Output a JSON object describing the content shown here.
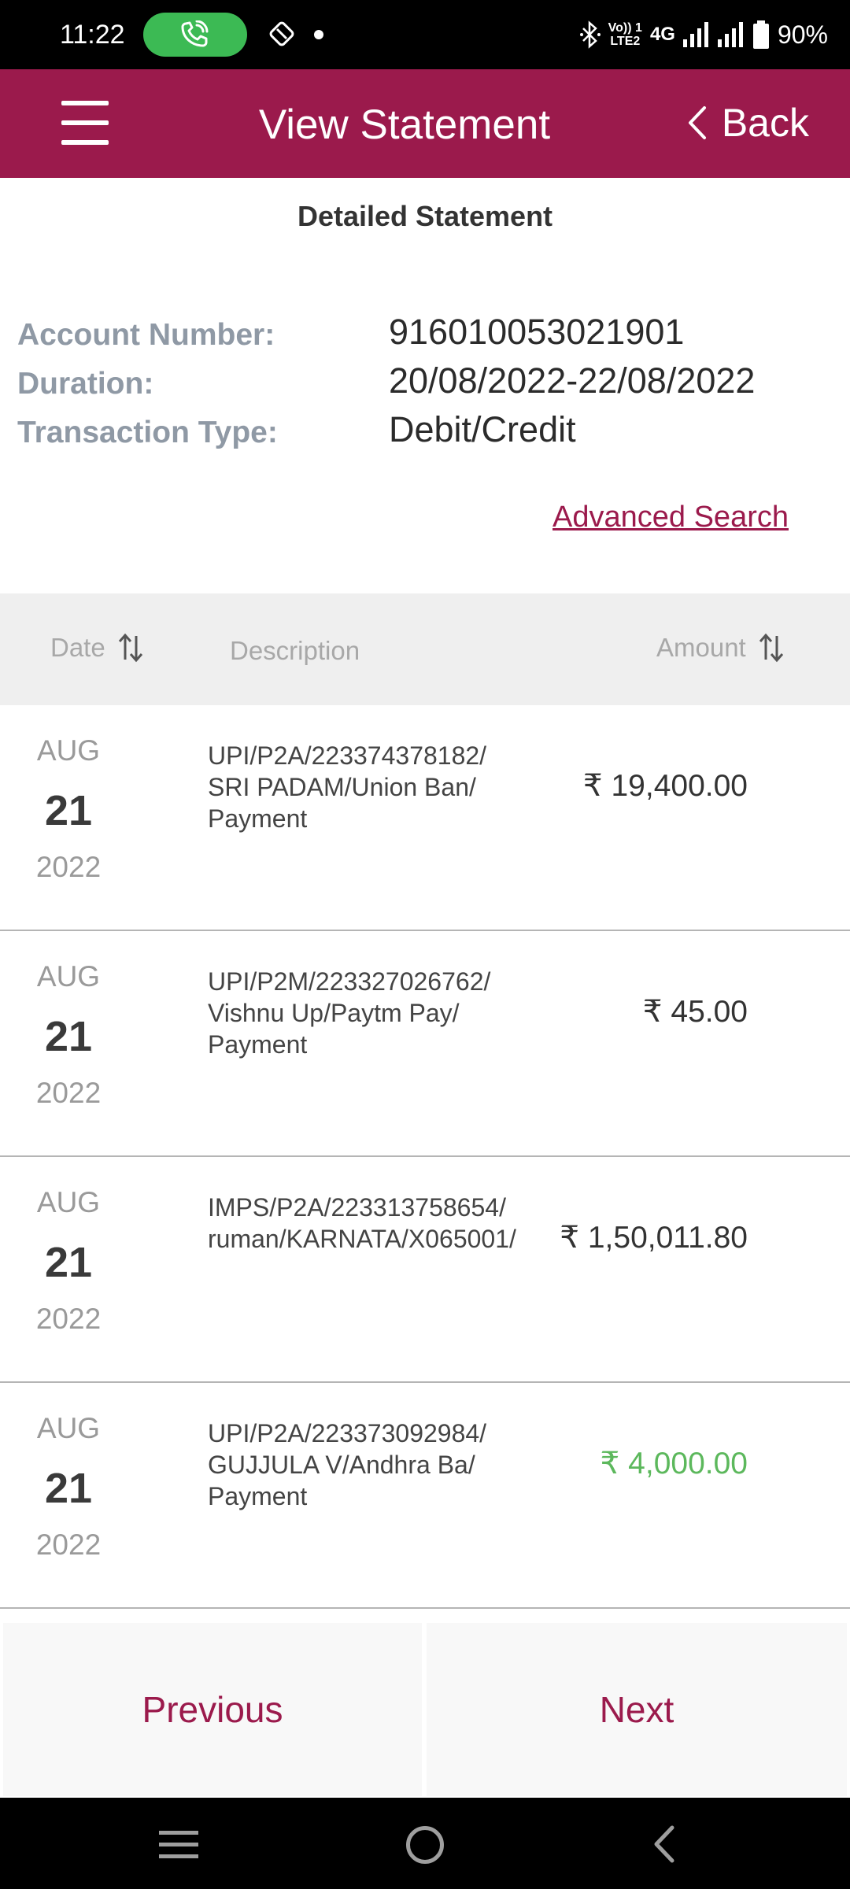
{
  "status_bar": {
    "time": "11:22",
    "network_top": "Vo)) 1",
    "network_bottom": "LTE2",
    "network_type": "4G",
    "battery": "90%"
  },
  "header": {
    "title": "View Statement",
    "back_label": "Back"
  },
  "statement": {
    "section_title": "Detailed Statement",
    "account_label": "Account Number:",
    "account_value": "916010053021901",
    "duration_label": "Duration:",
    "duration_value": "20/08/2022-22/08/2022",
    "type_label": "Transaction Type:",
    "type_value": "Debit/Credit",
    "advanced_search": "Advanced Search"
  },
  "table": {
    "headers": {
      "date": "Date",
      "description": "Description",
      "amount": "Amount"
    },
    "rows": [
      {
        "month": "AUG",
        "day": "21",
        "year": "2022",
        "desc": [
          "UPI/P2A/223374378182/",
          "SRI PADAM/Union Ban/",
          "Payment"
        ],
        "amount": "₹ 19,400.00",
        "kind": "debit"
      },
      {
        "month": "AUG",
        "day": "21",
        "year": "2022",
        "desc": [
          "UPI/P2M/223327026762/",
          "Vishnu Up/Paytm Pay/",
          "Payment"
        ],
        "amount": "₹ 45.00",
        "kind": "debit"
      },
      {
        "month": "AUG",
        "day": "21",
        "year": "2022",
        "desc": [
          "IMPS/P2A/223313758654/",
          "ruman/KARNATA/X065001/",
          ""
        ],
        "amount": "₹ 1,50,011.80",
        "kind": "debit"
      },
      {
        "month": "AUG",
        "day": "21",
        "year": "2022",
        "desc": [
          "UPI/P2A/223373092984/",
          "GUJJULA V/Andhra Ba/",
          "Payment"
        ],
        "amount": "₹ 4,000.00",
        "kind": "credit"
      }
    ]
  },
  "pagination": {
    "previous": "Previous",
    "next": "Next"
  },
  "colors": {
    "brand": "#9b1a4c",
    "credit": "#5cb85c",
    "call_pill": "#3cba54"
  },
  "icons": {
    "menu": "hamburger-icon",
    "back": "chevron-left-icon",
    "sort": "sort-arrows-icon",
    "call": "phone-call-icon"
  }
}
